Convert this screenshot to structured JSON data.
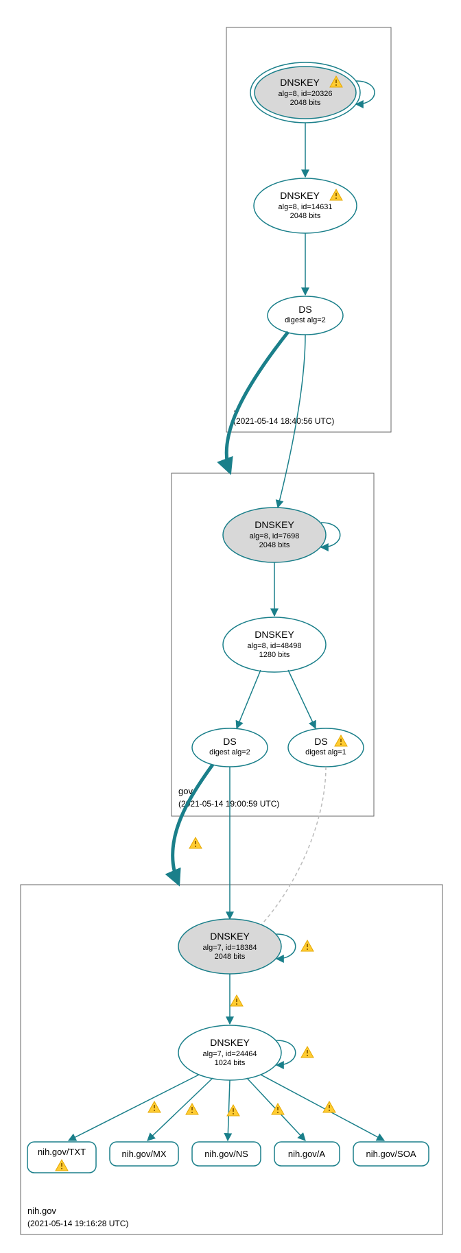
{
  "colors": {
    "stroke": "#1a7f8a",
    "ksk_fill": "#d8d8d8",
    "zone_border": "#666666",
    "dashed": "#bbbbbb"
  },
  "zones": {
    "root": {
      "label": ".",
      "timestamp": "(2021-05-14 18:40:56 UTC)",
      "nodes": {
        "ksk": {
          "title": "DNSKEY",
          "line2": "alg=8, id=20326",
          "line3": "2048 bits",
          "warn": true
        },
        "zsk": {
          "title": "DNSKEY",
          "line2": "alg=8, id=14631",
          "line3": "2048 bits",
          "warn": true
        },
        "ds": {
          "title": "DS",
          "line2": "digest alg=2"
        }
      }
    },
    "gov": {
      "label": "gov",
      "timestamp": "(2021-05-14 19:00:59 UTC)",
      "nodes": {
        "ksk": {
          "title": "DNSKEY",
          "line2": "alg=8, id=7698",
          "line3": "2048 bits",
          "warn": false
        },
        "zsk": {
          "title": "DNSKEY",
          "line2": "alg=8, id=48498",
          "line3": "1280 bits",
          "warn": false
        },
        "ds1": {
          "title": "DS",
          "line2": "digest alg=2",
          "warn": false
        },
        "ds2": {
          "title": "DS",
          "line2": "digest alg=1",
          "warn": true
        }
      }
    },
    "nih": {
      "label": "nih.gov",
      "timestamp": "(2021-05-14 19:16:28 UTC)",
      "nodes": {
        "ksk": {
          "title": "DNSKEY",
          "line2": "alg=7, id=18384",
          "line3": "2048 bits",
          "warn": false
        },
        "zsk": {
          "title": "DNSKEY",
          "line2": "alg=7, id=24464",
          "line3": "1024 bits",
          "warn": false
        },
        "rr": {
          "txt": "nih.gov/TXT",
          "mx": "nih.gov/MX",
          "ns": "nih.gov/NS",
          "a": "nih.gov/A",
          "soa": "nih.gov/SOA"
        }
      }
    }
  }
}
